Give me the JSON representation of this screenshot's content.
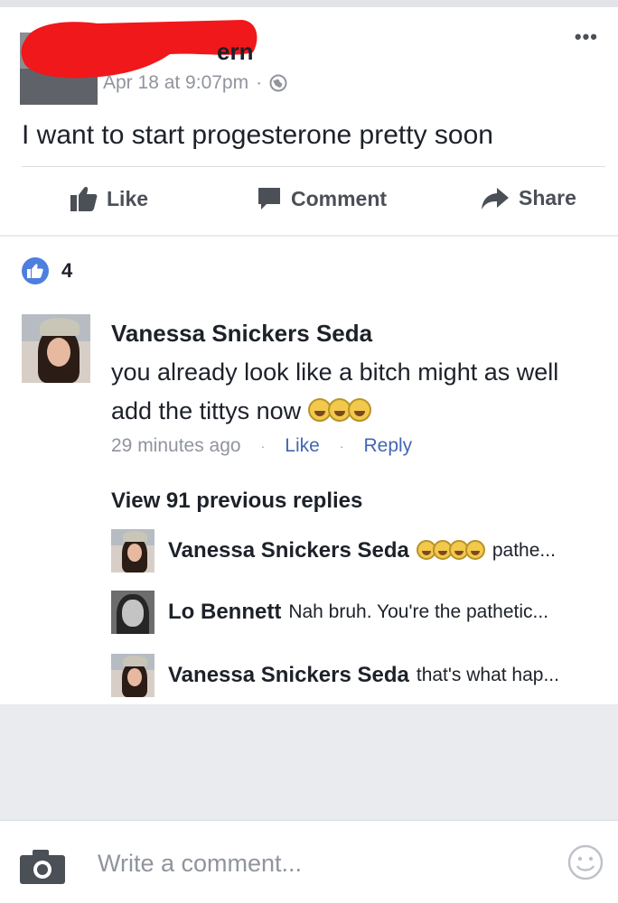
{
  "post": {
    "author_name_visible": "ern",
    "timestamp": "Apr 18 at 9:07pm",
    "separator": "·",
    "privacy_icon": "globe-icon",
    "more_icon": "ellipsis-icon",
    "text": "I want to start progesterone pretty soon",
    "actions": {
      "like": "Like",
      "comment": "Comment",
      "share": "Share"
    },
    "reactions": {
      "icon": "thumbs-up-icon",
      "count": "4"
    }
  },
  "comment": {
    "author": "Vanessa Snickers Seda",
    "text": "you already look like a bitch might as well add the tittys now",
    "emoji_count": 3,
    "time": "29 minutes ago",
    "like": "Like",
    "reply": "Reply",
    "dot": "·"
  },
  "view_previous": "View 91 previous replies",
  "replies": [
    {
      "author": "Vanessa Snickers Seda",
      "text": "pathe...",
      "emoji_count": 4
    },
    {
      "author": "Lo Bennett",
      "text": "Nah bruh. You're the pathetic...",
      "emoji_count": 0
    },
    {
      "author": "Vanessa Snickers Seda",
      "text": "that's what hap...",
      "emoji_count": 0
    }
  ],
  "composer": {
    "placeholder": "Write a comment...",
    "camera_icon": "camera-icon",
    "emoji_icon": "smiley-icon"
  },
  "colors": {
    "link_blue": "#4267b2",
    "like_blue": "#4e7fe0",
    "redaction_red": "#f0181b",
    "meta_grey": "#90949c"
  }
}
